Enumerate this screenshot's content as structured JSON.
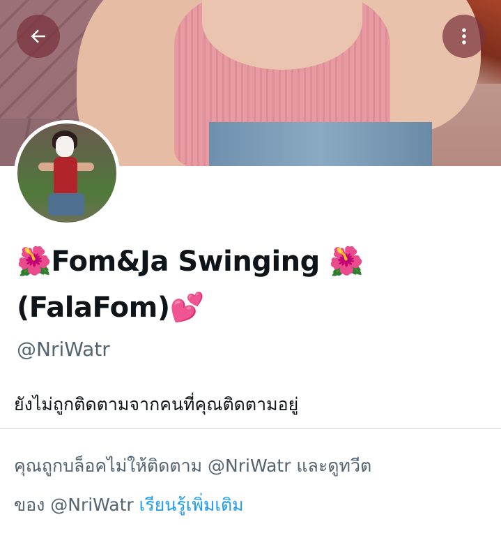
{
  "header": {
    "back_icon": "arrow-left-icon",
    "more_icon": "more-vertical-icon"
  },
  "profile": {
    "display_name_before": "🌺",
    "display_name_main": "Fom&Ja Swinging",
    "display_name_after": " 🌺",
    "display_name_line2": "(FalaFom)",
    "display_name_emoji": "💕",
    "handle": "@NriWatr",
    "follow_status": "ยังไม่ถูกติดตามจากคนที่คุณติดตามอยู่"
  },
  "blocked_notice": {
    "line1": "คุณถูกบล็อคไม่ให้ติดตาม @NriWatr และดูทวีต",
    "line2_prefix": "ของ @NriWatr",
    "learn_more": "เรียนรู้เพิ่มเติม"
  },
  "colors": {
    "link": "#1d9bf0",
    "secondary_text": "#536471",
    "button_bg": "rgba(120,50,60,0.72)"
  }
}
